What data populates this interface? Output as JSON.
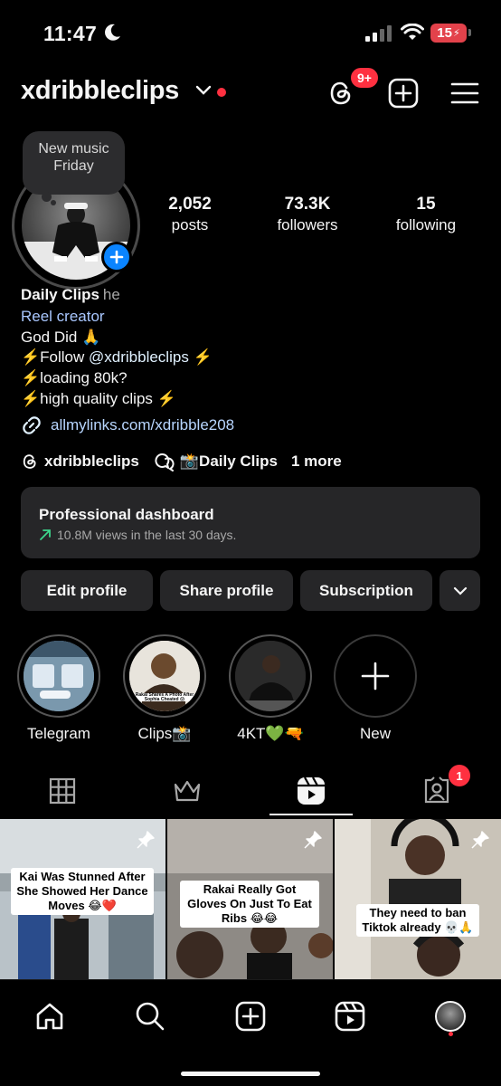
{
  "status_bar": {
    "time": "11:47",
    "battery": "15"
  },
  "header": {
    "username": "xdribbleclips",
    "notification_badge": "9+"
  },
  "profile": {
    "note": "New music Friday",
    "stats": [
      {
        "value": "2,052",
        "label": "posts"
      },
      {
        "value": "73.3K",
        "label": "followers"
      },
      {
        "value": "15",
        "label": "following"
      }
    ],
    "name": "Daily Clips",
    "pronouns": "he",
    "category": "Reel creator",
    "bio": {
      "line1": "God Did 🙏",
      "line2_prefix": "⚡️Follow ",
      "line2_mention": "@xdribbleclips",
      "line2_suffix": " ⚡️",
      "line3": "⚡️loading 80k?",
      "line4": "⚡️high quality clips ⚡️"
    },
    "link": "allmylinks.com/xdribble208",
    "threads_handle": "xdribbleclips",
    "channel_name": "📸Daily Clips",
    "more_label": "1 more"
  },
  "dashboard": {
    "title": "Professional dashboard",
    "subtitle": "10.8M views in the last 30 days."
  },
  "buttons": {
    "edit": "Edit profile",
    "share": "Share profile",
    "subscription": "Subscription"
  },
  "highlights": [
    {
      "label": "Telegram"
    },
    {
      "label": "Clips📸"
    },
    {
      "label": "4KT💚🔫"
    },
    {
      "label": "New"
    }
  ],
  "tabs": {
    "tagged_badge": "1"
  },
  "grid": [
    {
      "caption": "Kai Was Stunned After She Showed Her Dance Moves 😂❤️"
    },
    {
      "caption": "Rakai Really Got Gloves On Just To Eat Ribs 😂😂"
    },
    {
      "caption": "They need to ban Tiktok already 💀🙏"
    }
  ],
  "thumbnail_text": {
    "highlight2": "Rakai Shares A Photo After Sophia Cheated 😱"
  },
  "colors": {
    "accent_blue": "#0a84ff",
    "badge_red": "#ff3040",
    "surface": "#262628"
  }
}
